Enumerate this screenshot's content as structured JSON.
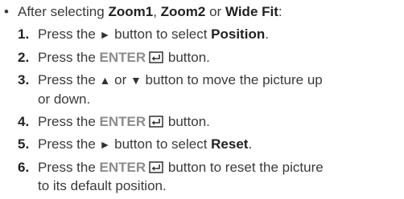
{
  "intro": {
    "prefix": "After selecting ",
    "option1": "Zoom1",
    "sep1": ", ",
    "option2": "Zoom2",
    "conj": " or ",
    "option3": "Wide Fit",
    "suffix": ":"
  },
  "icons": {
    "bullet": "bullet-dot",
    "right_arrow": "right-triangle",
    "up_arrow": "up-triangle",
    "down_arrow": "down-triangle",
    "enter": "enter-return-icon"
  },
  "steps": [
    {
      "num": "1.",
      "text_a": "Press the ",
      "arrow": "►",
      "text_b": " button to select ",
      "bold": "Position",
      "text_c": "."
    },
    {
      "num": "2.",
      "text_a": "Press the ",
      "enter": "ENTER",
      "text_b": " button."
    },
    {
      "num": "3.",
      "text_a": "Press the ",
      "up": "▲",
      "or": " or ",
      "down": "▼",
      "line1": " button to move the picture up",
      "line2": "or down."
    },
    {
      "num": "4.",
      "text_a": "Press the ",
      "enter": "ENTER",
      "text_b": " button."
    },
    {
      "num": "5.",
      "text_a": "Press the ",
      "arrow": "►",
      "text_b": " button to select ",
      "bold": "Reset",
      "text_c": "."
    },
    {
      "num": "6.",
      "text_a": "Press the ",
      "enter": "ENTER",
      "line1": " button to reset the picture",
      "line2": "to its default position."
    }
  ],
  "colors": {
    "text": "#3a3a3a",
    "bold": "#222222",
    "enter_label": "#8c8c8c"
  }
}
